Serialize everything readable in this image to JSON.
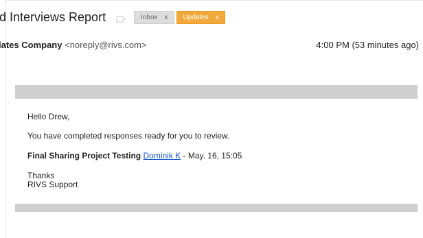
{
  "email": {
    "subject": "d Interviews Report",
    "labels": [
      {
        "name": "Inbox",
        "remove": "x",
        "color": "#dddddd"
      },
      {
        "name": "Updates",
        "remove": "x",
        "color": "#f2a93b"
      }
    ],
    "sender_name": "lates Company",
    "sender_email": "<noreply@rivs.com>",
    "timestamp": "4:00 PM (53 minutes ago)"
  },
  "body": {
    "greeting": "Hello Drew,",
    "intro": "You have completed responses ready for you to review.",
    "project_name": "Final Sharing Project Testing",
    "assignee": "Dominik K",
    "date_suffix": " - May. 16, 15:05",
    "thanks": "Thanks",
    "signature": "RIVS Support"
  },
  "colors": {
    "accent_link": "#1155cc",
    "updates_label": "#f2a93b",
    "banner_gray": "#cfcfcf"
  },
  "icons": {
    "importance": "importance-marker-icon"
  }
}
